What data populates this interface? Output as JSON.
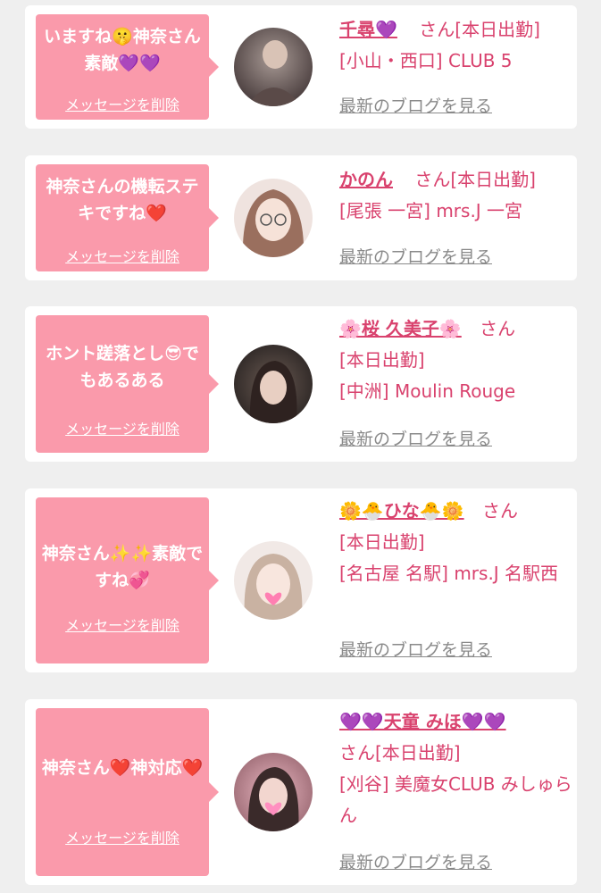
{
  "cards": [
    {
      "message": "いますね🤫神奈さん素敵💜💜",
      "delete_label": "メッセージを削除",
      "name": "千尋💜",
      "san": "さん",
      "status": "[本日出勤]",
      "shop": "[小山・西口] CLUB 5",
      "blog_link": "最新のブログを見る"
    },
    {
      "message": "神奈さんの機転ステキですね❤️",
      "delete_label": "メッセージを削除",
      "name": "かのん",
      "san": "さん",
      "status": "[本日出勤]",
      "shop": "[尾張 一宮] mrs.J 一宮",
      "blog_link": "最新のブログを見る"
    },
    {
      "message": "ホント蹉落とし😎でもあるある",
      "delete_label": "メッセージを削除",
      "name": "🌸桜 久美子🌸",
      "san": "さん",
      "status": "[本日出勤]",
      "shop": "[中洲] Moulin Rouge",
      "blog_link": "最新のブログを見る"
    },
    {
      "message": "神奈さん✨✨素敵ですね💞",
      "delete_label": "メッセージを削除",
      "name": "🌼🐣ひな🐣🌼",
      "san": "さん",
      "status": "[本日出勤]",
      "shop": "[名古屋 名駅] mrs.J 名駅西",
      "blog_link": "最新のブログを見る"
    },
    {
      "message": "神奈さん❤️神対応❤️",
      "delete_label": "メッセージを削除",
      "name": "💜💜天童 みほ💜💜",
      "san": "さん",
      "status": "[本日出勤]",
      "shop": "[刈谷] 美魔女CLUB みしゅらん",
      "blog_link": "最新のブログを見る"
    }
  ],
  "colors": {
    "page_bg": "#efefef",
    "card_bg": "#ffffff",
    "bubble": "#fa9aab",
    "name": "#d9426e",
    "link": "#8a8a8a"
  }
}
